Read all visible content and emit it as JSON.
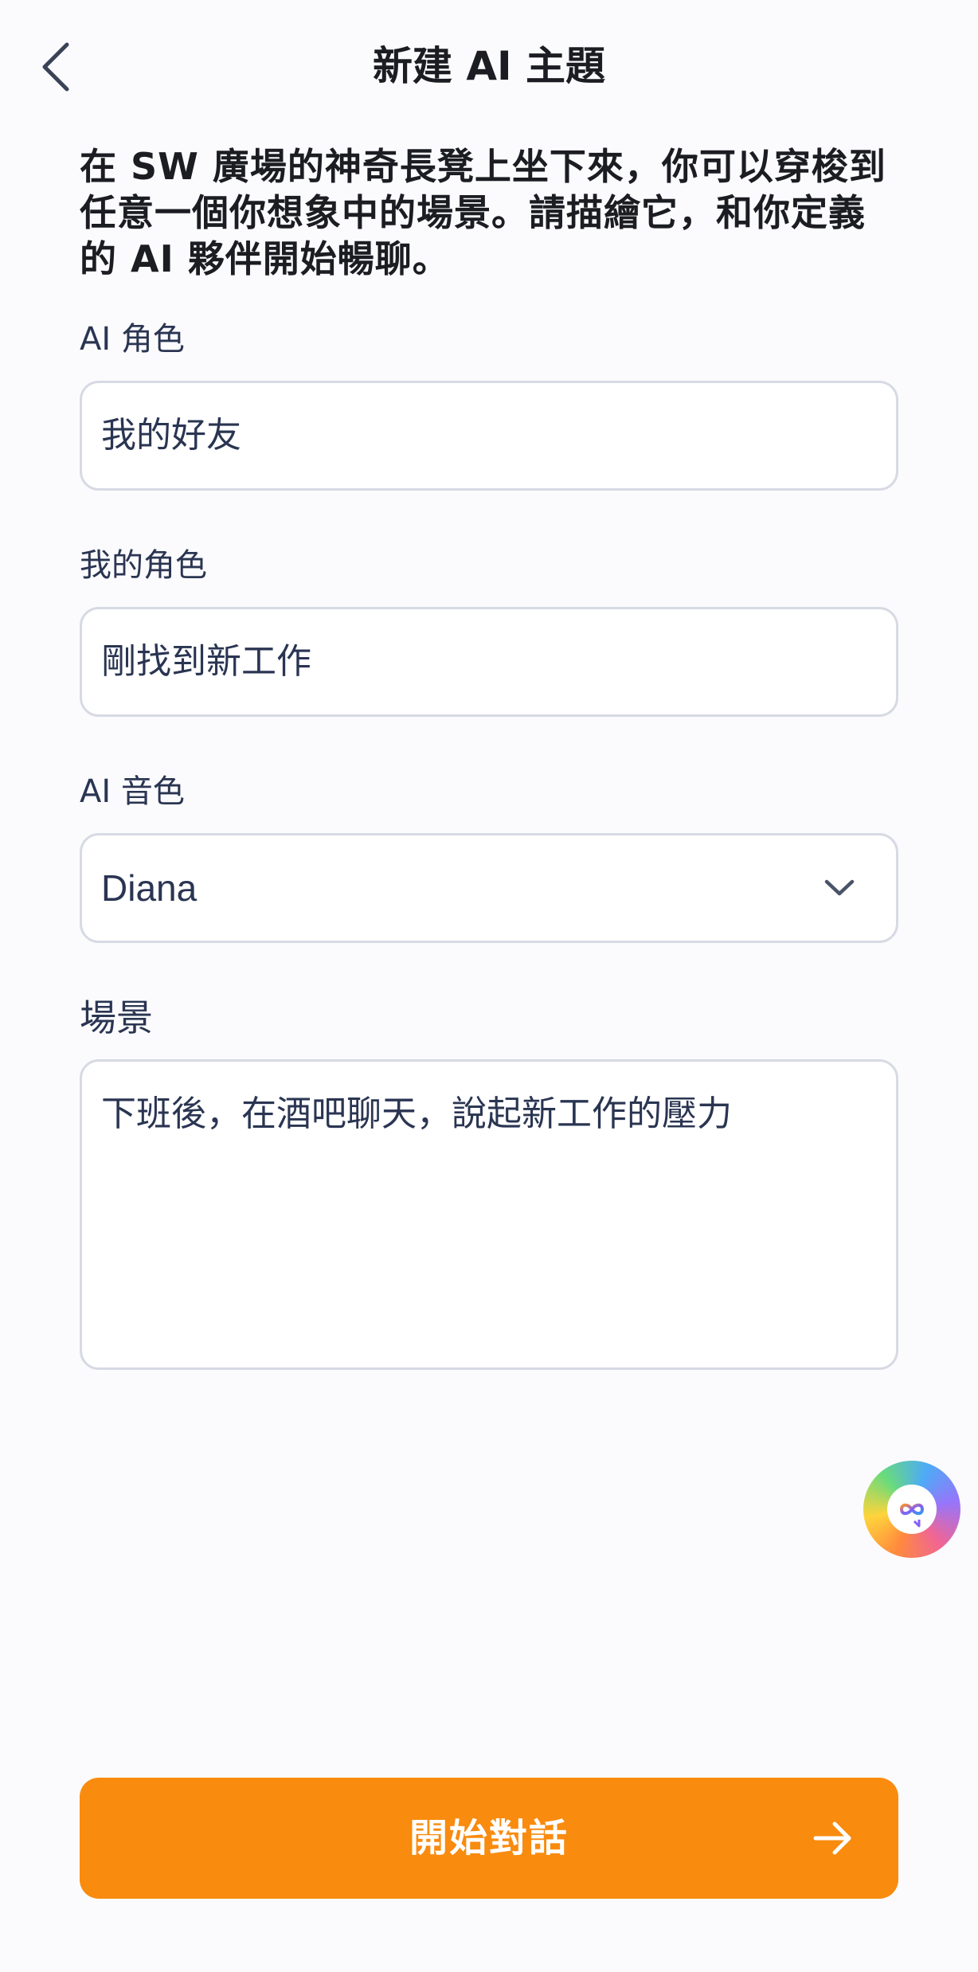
{
  "header": {
    "title": "新建 AI 主題"
  },
  "intro": {
    "text": "在 SW 廣場的神奇長凳上坐下來，你可以穿梭到任意一個你想象中的場景。請描繪它，和你定義的 AI 夥伴開始暢聊。"
  },
  "form": {
    "ai_role": {
      "label": "AI 角色",
      "value": "我的好友"
    },
    "my_role": {
      "label": "我的角色",
      "value": "剛找到新工作"
    },
    "ai_voice": {
      "label": "AI 音色",
      "value": "Diana"
    },
    "scene": {
      "label": "場景",
      "value": "下班後，在酒吧聊天，說起新工作的壓力"
    }
  },
  "actions": {
    "start_label": "開始對話"
  },
  "icons": {
    "back": "chevron-left-icon",
    "dropdown": "chevron-down-icon",
    "assistant": "infinity-chat-icon",
    "arrow": "arrow-right-icon"
  },
  "colors": {
    "accent": "#f98b0f",
    "text_primary": "#1b1d22",
    "text_field": "#2a3552",
    "border": "#d7dae3",
    "background": "#fbfbfd"
  }
}
